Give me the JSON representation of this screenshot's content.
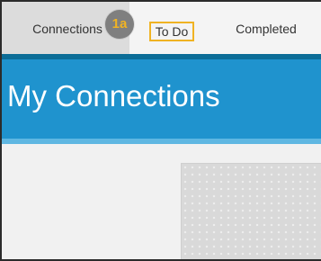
{
  "tabs": {
    "connections": "Connections",
    "todo": "To Do",
    "completed": "Completed"
  },
  "callout": {
    "label": "1a"
  },
  "header": {
    "title": "My Connections"
  },
  "colors": {
    "header_blue": "#1f93ce",
    "accent_dark_blue": "#0c6d97",
    "highlight_orange": "#f0b323",
    "callout_gray": "#7f7f7f"
  }
}
